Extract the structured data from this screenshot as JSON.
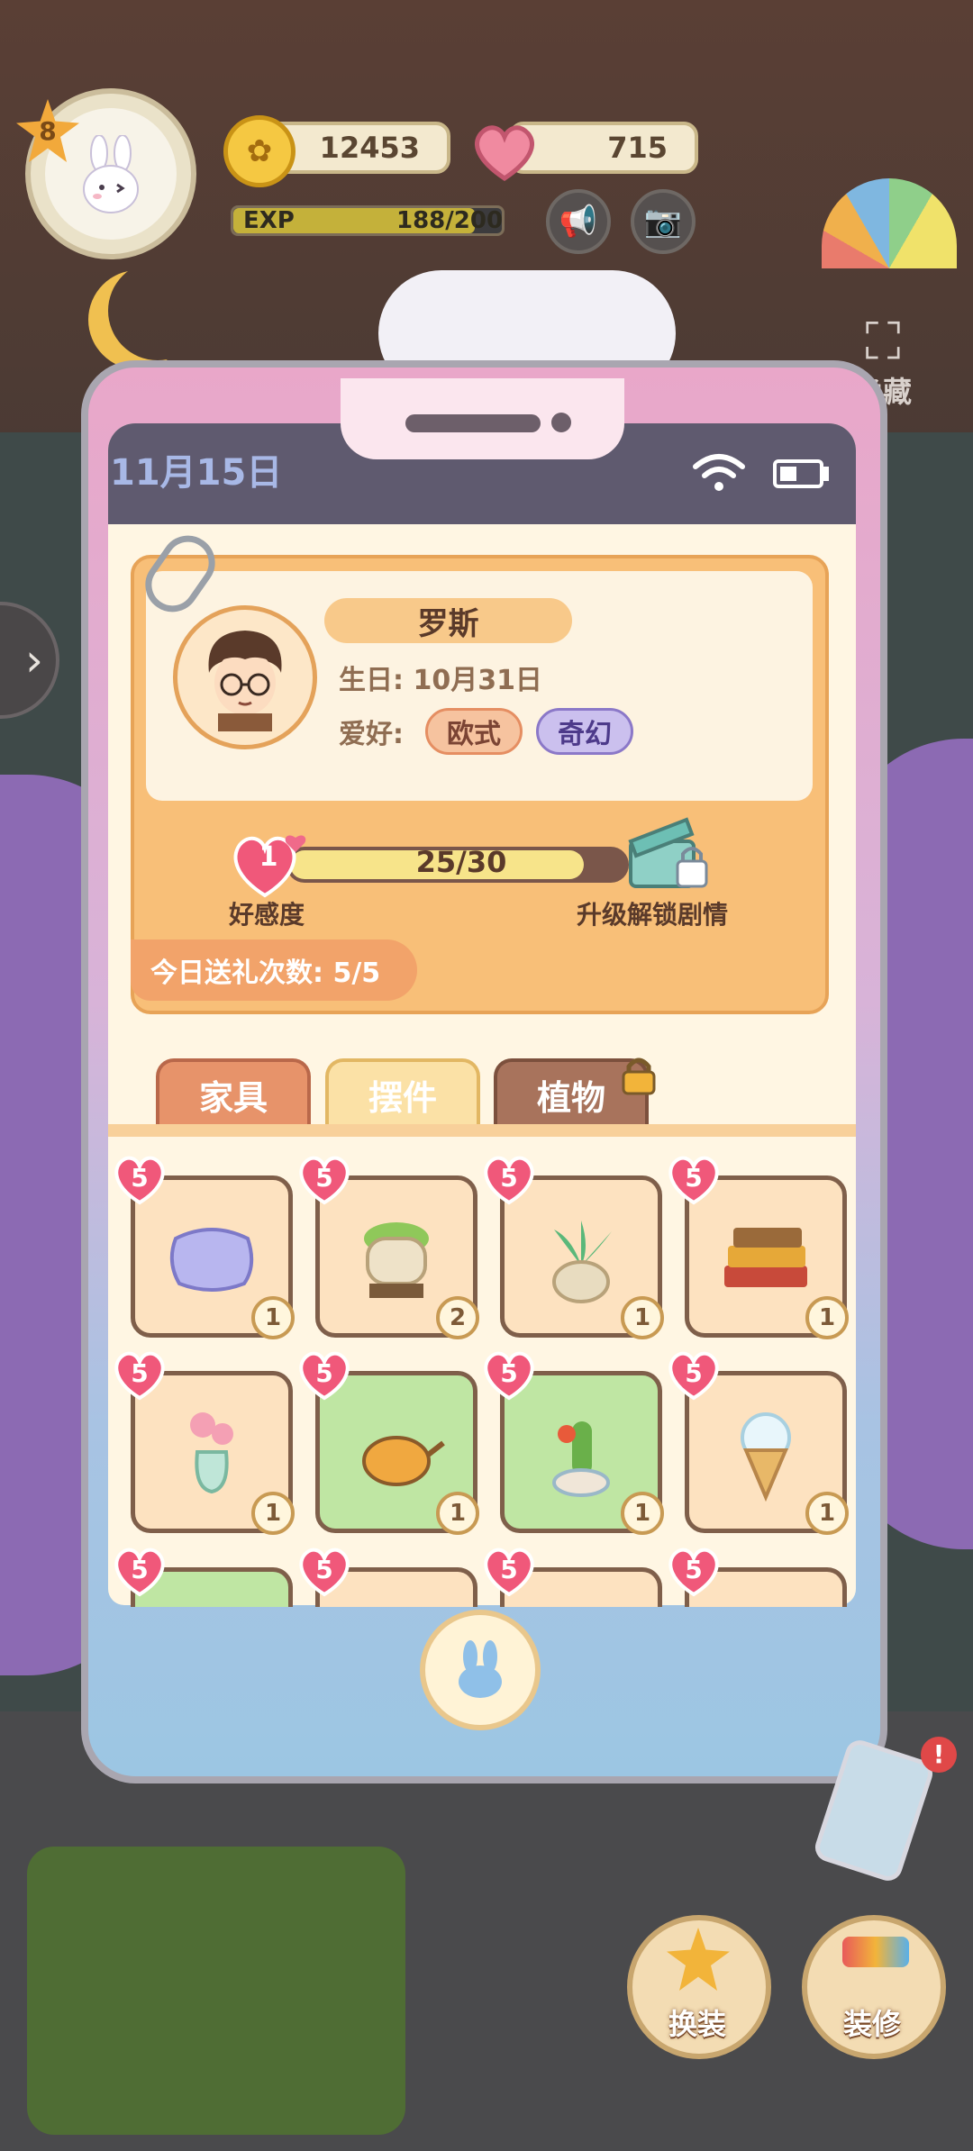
{
  "hud": {
    "level": "8",
    "coins": "12453",
    "hearts": "715",
    "exp_label": "EXP",
    "exp_value": "188/200",
    "exp_progress": 0.94,
    "hide_label": "隐藏"
  },
  "phone": {
    "date": "11月15日"
  },
  "profile": {
    "name": "罗斯",
    "birthday": "生日: 10月31日",
    "hobby_label": "爱好:",
    "hobbies": [
      "欧式",
      "奇幻"
    ],
    "affection_level": "1",
    "affection_value": "25/30",
    "affection_progress": 0.833,
    "affection_label": "好感度",
    "unlock_label": "升级解锁剧情",
    "gift_count": "今日送礼次数: 5/5"
  },
  "tabs": [
    "家具",
    "摆件",
    "植物"
  ],
  "items": [
    {
      "icon": "pillow-icon",
      "heart": "5",
      "qty": "1",
      "bg": "peach"
    },
    {
      "icon": "pot-plant-icon",
      "heart": "5",
      "qty": "2",
      "bg": "peach"
    },
    {
      "icon": "leafy-plant-icon",
      "heart": "5",
      "qty": "1",
      "bg": "peach"
    },
    {
      "icon": "books-icon",
      "heart": "5",
      "qty": "1",
      "bg": "peach"
    },
    {
      "icon": "flower-vase-icon",
      "heart": "5",
      "qty": "1",
      "bg": "peach"
    },
    {
      "icon": "teapot-icon",
      "heart": "5",
      "qty": "1",
      "bg": "green"
    },
    {
      "icon": "cactus-icon",
      "heart": "5",
      "qty": "1",
      "bg": "green"
    },
    {
      "icon": "ice-cream-icon",
      "heart": "5",
      "qty": "1",
      "bg": "peach"
    },
    {
      "icon": "item-icon",
      "heart": "5",
      "qty": "",
      "bg": "green"
    },
    {
      "icon": "item-icon",
      "heart": "5",
      "qty": "",
      "bg": "peach"
    },
    {
      "icon": "item-icon",
      "heart": "5",
      "qty": "",
      "bg": "peach"
    },
    {
      "icon": "item-icon",
      "heart": "5",
      "qty": "",
      "bg": "peach"
    }
  ],
  "buttons": {
    "dress_up": "换装",
    "decorate": "装修"
  }
}
